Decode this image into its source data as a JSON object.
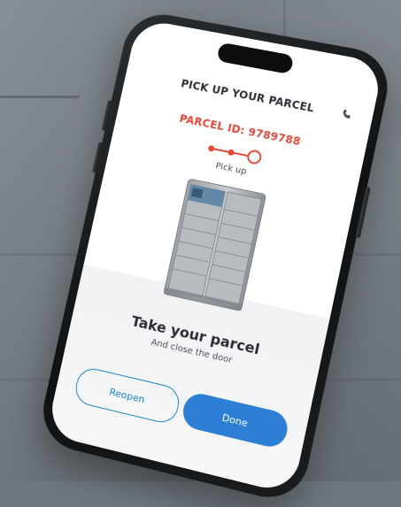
{
  "screen": {
    "title": "PICK UP YOUR PARCEL",
    "parcel_id": "PARCEL ID: 9789788",
    "step_label": "Pick up",
    "primary_text": "Take your parcel",
    "secondary_text": "And close the door",
    "buttons": {
      "reopen_label": "Reopen",
      "done_label": "Done"
    },
    "icons": {
      "call": "phone-icon",
      "stepper": "progress-stepper-icon",
      "locker": "locker-illustration"
    },
    "colors": {
      "accent_red": "#e5493a",
      "primary_blue": "#2d7fd6",
      "outline_blue": "#1786c9"
    }
  }
}
